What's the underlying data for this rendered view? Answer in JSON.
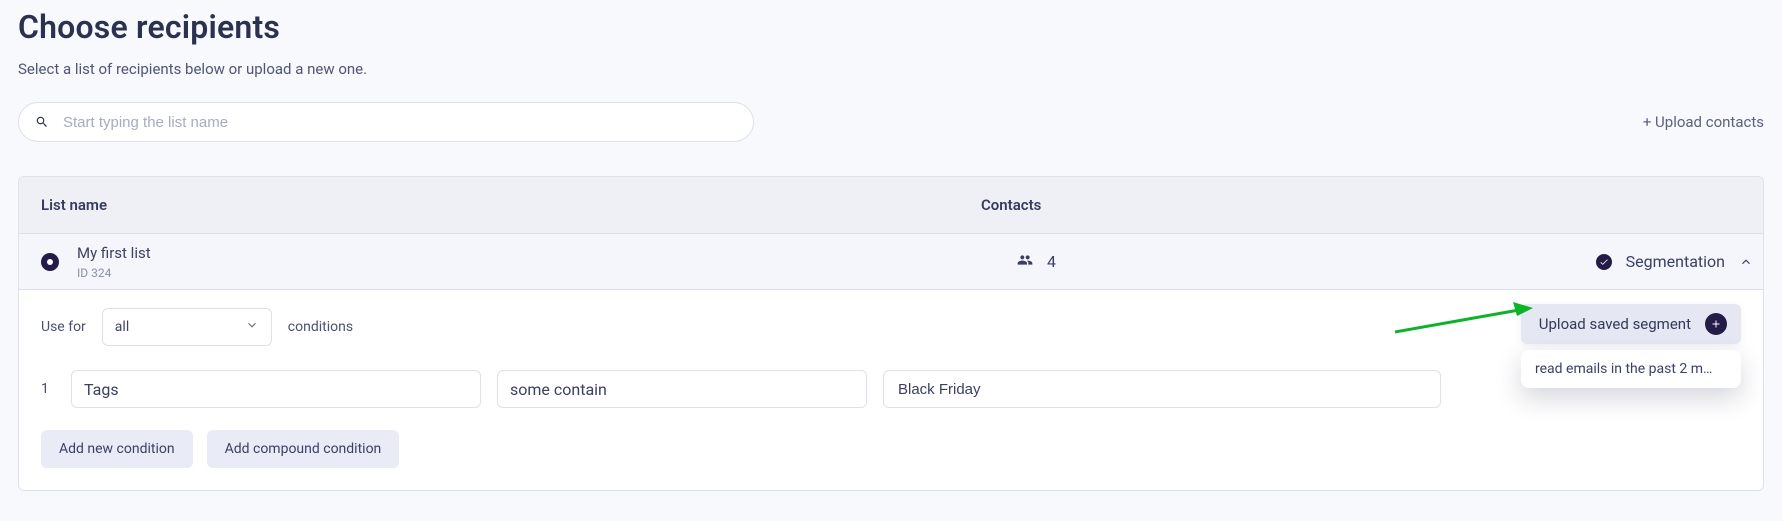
{
  "header": {
    "title": "Choose recipients",
    "subtitle": "Select a list of recipients below or upload a new one."
  },
  "search": {
    "placeholder": "Start typing the list name"
  },
  "actions": {
    "upload_contacts": "+ Upload contacts"
  },
  "table": {
    "columns": {
      "name": "List name",
      "contacts": "Contacts"
    },
    "rows": [
      {
        "selected": true,
        "name": "My first list",
        "id_label": "ID 324",
        "contacts": "4",
        "right_label": "Segmentation",
        "expanded": true
      }
    ]
  },
  "segmentation": {
    "usefor_label": "Use for",
    "match": "all",
    "conditions_label": "conditions",
    "upload_saved": "Upload saved segment",
    "conditions": [
      {
        "index": "1",
        "field": "Tags",
        "operator": "some contain",
        "value": "Black Friday"
      }
    ],
    "add_condition": "Add new condition",
    "add_compound": "Add compound condition",
    "saved_menu_item": "read emails in the past 2 m…"
  }
}
